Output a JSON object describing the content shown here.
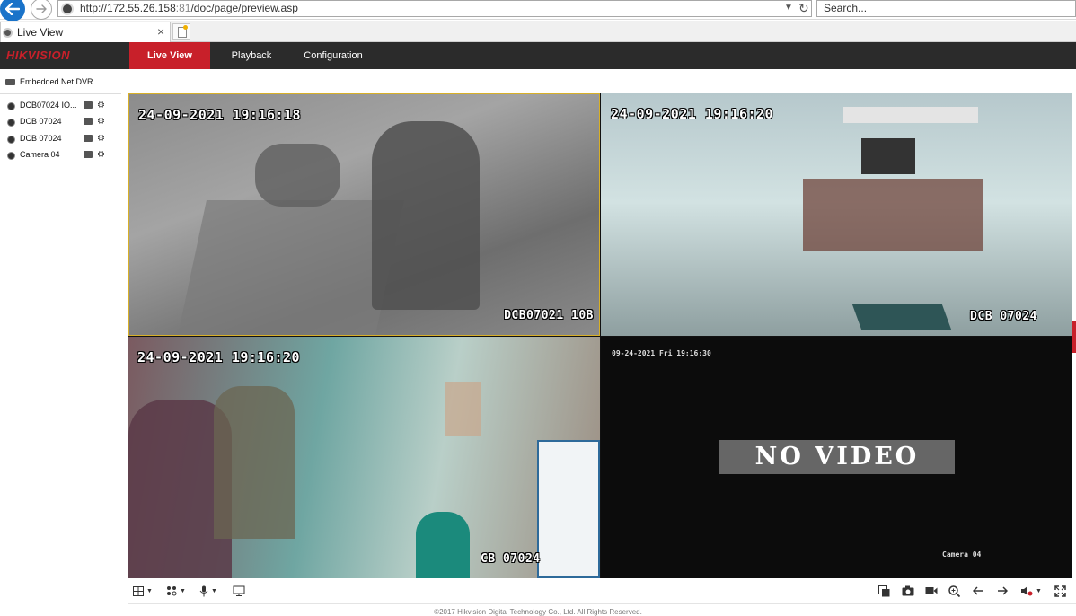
{
  "browser": {
    "url_host": "http://172.55.26.158",
    "url_port": ":81",
    "url_path": "/doc/page/preview.asp",
    "search_placeholder": "Search...",
    "tab_title": "Live View",
    "tab_close": "×"
  },
  "header": {
    "logo": "HIKVISION",
    "nav": {
      "live": "Live View",
      "playback": "Playback",
      "configuration": "Configuration"
    }
  },
  "sidebar": {
    "device": "Embedded Net DVR",
    "cameras": [
      "DCB07024 IO...",
      "DCB 07024",
      "DCB 07024",
      "Camera 04"
    ]
  },
  "videos": [
    {
      "timestamp": "24-09-2021 19:16:18",
      "name": "DCB07021 10B"
    },
    {
      "timestamp": "24-09-2021 19:16:20",
      "name": "DCB 07024"
    },
    {
      "timestamp": "24-09-2021 19:16:20",
      "name": "CB 07024"
    },
    {
      "timestamp": "09-24-2021 Fri 19:16:30",
      "name": "Camera 04",
      "status": "NO VIDEO"
    }
  ],
  "footer": "©2017 Hikvision Digital Technology Co., Ltd. All Rights Reserved.",
  "colors": {
    "brand_red": "#c8202a",
    "header_bg": "#2b2b2b",
    "selected_border": "#d8b028"
  }
}
